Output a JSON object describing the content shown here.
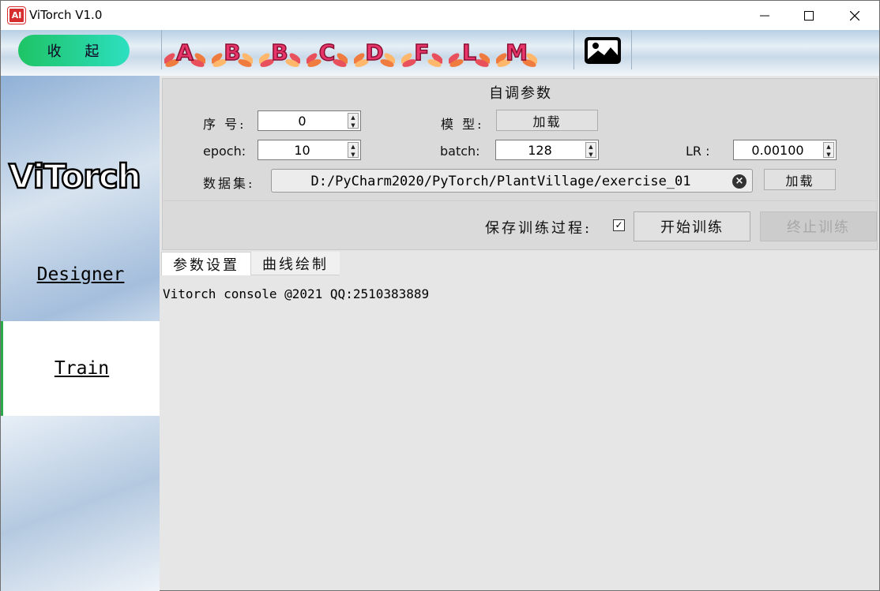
{
  "window": {
    "title": "ViTorch V1.0",
    "app_icon_text": "AI"
  },
  "toolbar": {
    "collapse_label": "收 起",
    "letters": [
      "A",
      "B",
      "B",
      "C",
      "D",
      "F",
      "L",
      "M"
    ],
    "image_icon": "image-icon"
  },
  "sidebar": {
    "logo": "ViTorch",
    "items": [
      {
        "label": "Designer",
        "selected": false
      },
      {
        "label": "Train",
        "selected": true
      }
    ],
    "selected_accent": "#2aa84a"
  },
  "params": {
    "title": "自调参数",
    "index_label": "序 号:",
    "index_value": "0",
    "model_label": "模 型:",
    "model_load_label": "加载",
    "epoch_label": "epoch:",
    "epoch_value": "10",
    "batch_label": "batch:",
    "batch_value": "128",
    "lr_label": "LR :",
    "lr_value": "0.00100",
    "dataset_label": "数据集:",
    "dataset_path": "D:/PyCharm2020/PyTorch/PlantVillage/exercise_01",
    "dataset_load_label": "加载",
    "save_process_label": "保存训练过程:",
    "save_process_checked": true,
    "start_label": "开始训练",
    "stop_label": "终止训练"
  },
  "tabs": [
    {
      "label": "参数设置",
      "active": true
    },
    {
      "label": "曲线绘制",
      "active": false
    }
  ],
  "console": {
    "text": "Vitorch console @2021 QQ:2510383889"
  }
}
